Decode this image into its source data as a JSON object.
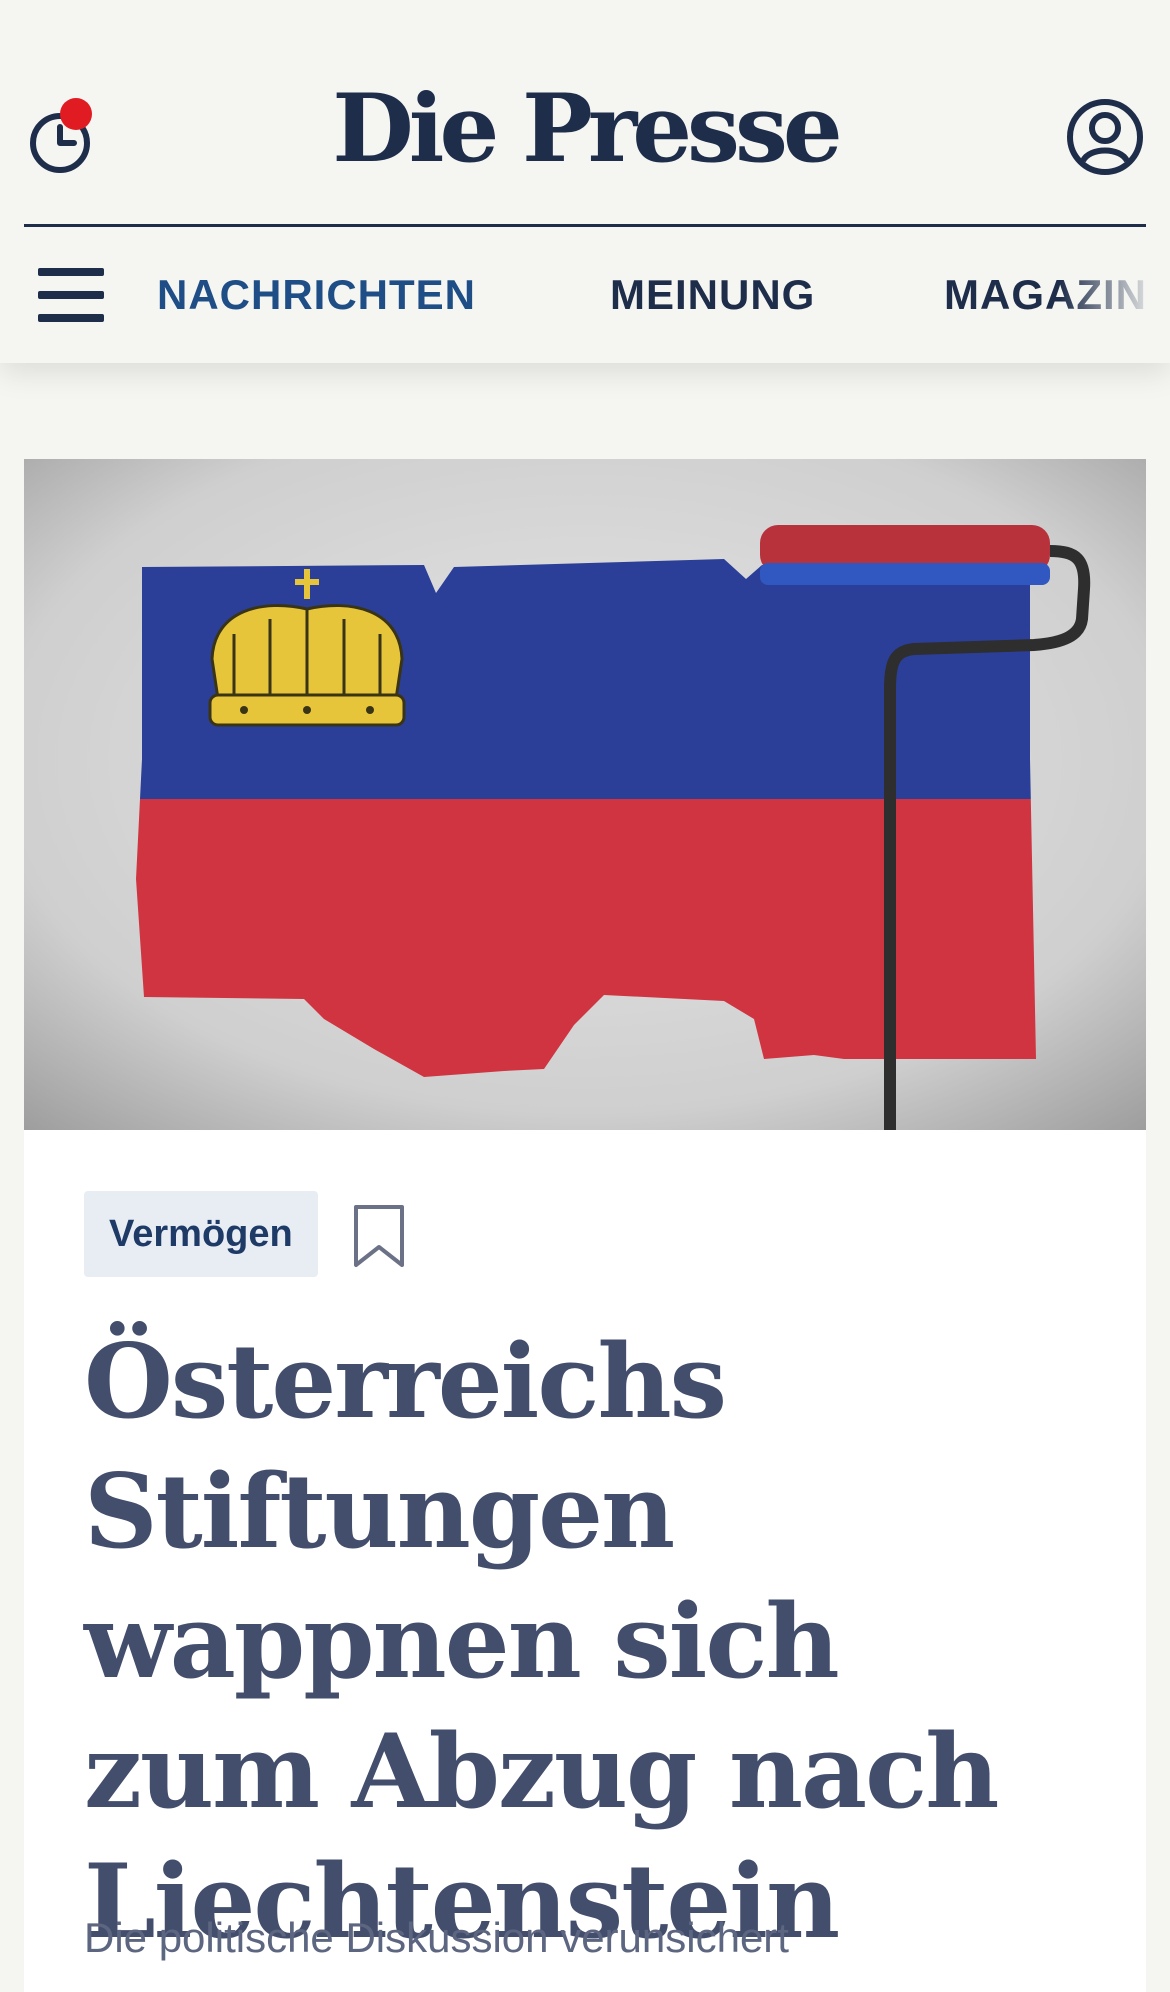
{
  "header": {
    "logo": "Die Presse",
    "history_icon": "clock-history-icon",
    "account_icon": "user-account-icon",
    "menu_icon": "hamburger-menu-icon",
    "notification_color": "#e11b22"
  },
  "nav": {
    "items": [
      {
        "label": "NACHRICHTEN",
        "active": true
      },
      {
        "label": "MEINUNG",
        "active": false
      },
      {
        "label": "MAGAZIN",
        "active": false
      }
    ]
  },
  "article": {
    "image_alt": "Liechtenstein-Flagge wird mit Farbroller an eine Wand gemalt",
    "category": "Vermögen",
    "bookmark_icon": "bookmark-icon",
    "headline": "Österreichs Stiftungen wappnen sich zum Abzug nach Liechtenstein",
    "lead": "Die politische Diskussion verunsichert"
  },
  "colors": {
    "brand_navy": "#1e2d4a",
    "nav_active": "#1f4e87",
    "flag_blue": "#2b3f99",
    "flag_red": "#cf3440",
    "crown_gold": "#e6c53a"
  }
}
